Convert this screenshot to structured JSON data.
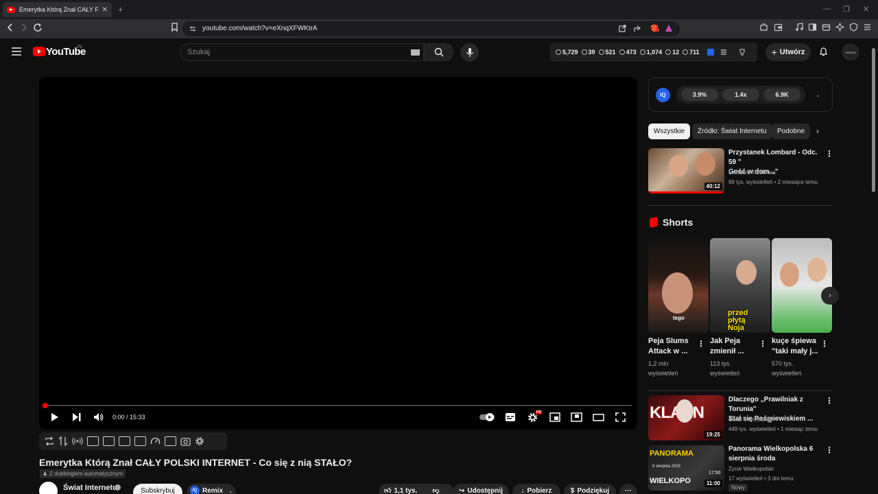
{
  "browser": {
    "tab_title": "Emerytka Którą Znał CAŁY POLSKI",
    "tab_close": "✕",
    "new_tab": "+",
    "url": "youtube.com/watch?v=eXnqXFWKtrA"
  },
  "masthead": {
    "logo_text": "YouTube",
    "region": "PL",
    "search_placeholder": "Szukaj",
    "create_label": "Utwórz",
    "avatar_text": "ARROW"
  },
  "stats": [
    {
      "icon": "clock-icon",
      "value": "5,729"
    },
    {
      "icon": "eye-icon",
      "value": "39"
    },
    {
      "icon": "eye-icon",
      "value": "521"
    },
    {
      "icon": "money-icon",
      "value": "473"
    },
    {
      "icon": "eye-icon",
      "value": "1,074"
    },
    {
      "icon": "clock-icon",
      "value": "12"
    },
    {
      "icon": "person-icon",
      "value": "711"
    }
  ],
  "player": {
    "time": "0:00 / 15:33",
    "progress_fraction": 0.0,
    "hd_badge": "HD"
  },
  "video": {
    "title": "Emerytka Którą Znał CAŁY POLSKI INTERNET - Co się z nią STAŁO?",
    "dub_label": "Z dubbingiem automatycznym",
    "channel": "Świat Internetu",
    "subscribe": "Subskrybuj",
    "remix": "Remix",
    "remix_badge": "IQ",
    "likes": "1,1 tys.",
    "share": "Udostępnij",
    "download": "Pobierz",
    "thanks": "Podziękuj",
    "more": "···"
  },
  "iq": {
    "logo": "IQ",
    "pills": [
      "3.9%",
      "1.4x",
      "6.9K"
    ]
  },
  "chips": [
    "Wszystkie",
    "Źródło: Świat Internetu",
    "Podobne"
  ],
  "recommended_top": {
    "title_line1": "Przystanek Lombard - Odc. 59 \"",
    "title_line2": "Gość w dom...\"",
    "channel": "Lombard Trzebnica",
    "meta": "99 tys. wyświetleń • 2 miesiące temu",
    "duration": "40:12"
  },
  "shorts": {
    "label": "Shorts",
    "items": [
      {
        "title_line1": "Peja Slums",
        "title_line2": "Attack w ...",
        "meta_line1": "1,2 mln",
        "meta_line2": "wyświetleń"
      },
      {
        "title_line1": "Jak Peja",
        "title_line2": "zmienił ...",
        "meta_line1": "113 tys.",
        "meta_line2": "wyświetleń"
      },
      {
        "title_line1": "kuçe śpiewa",
        "title_line2": "\"taki mały j...",
        "meta_line1": "570 tys.",
        "meta_line2": "wyświetleń"
      }
    ],
    "thumb_caption_1": "tego",
    "thumb_caption_2a": "przed",
    "thumb_caption_2b": "płytą",
    "thumb_caption_2c": "Noja"
  },
  "recommended": [
    {
      "title_line1": "Dlaczego „Prawilniak z Torunia\"",
      "title_line2": "Stał się Pośmiewiskiem ...",
      "channel": "Świat Internetu",
      "meta": "449 tys. wyświetleń • 1 miesiąc temu",
      "duration": "19:25",
      "thumb_text": "KLAUN"
    },
    {
      "title_line1": "Panorama Wielkopolska 6",
      "title_line2": "sierpnia środa",
      "channel": "Życie Wielkopolski",
      "meta": "17 wyświetleń • 3 dni temu",
      "duration": "11:00",
      "badge": "Nowy",
      "thumb_text": "PANORAMA",
      "thumb_sub": "6 sierpnia 2025",
      "thumb_time": "17:50",
      "thumb_bottom": "WIELKOPO"
    }
  ],
  "colors": {
    "accent": "#ff0000",
    "iq_blue": "#2563eb",
    "bg": "#0f0f0f"
  }
}
